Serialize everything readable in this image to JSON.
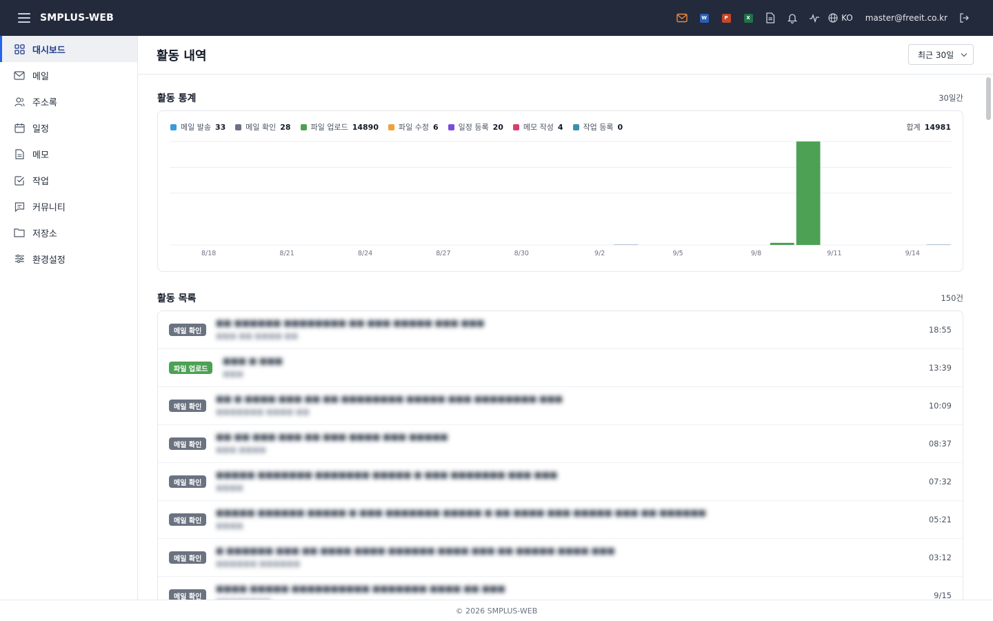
{
  "app": {
    "title": "SMPLUS-WEB"
  },
  "header": {
    "icons": [
      "mail-icon",
      "word-icon",
      "powerpoint-icon",
      "excel-icon",
      "document-icon",
      "bell-icon",
      "activity-icon"
    ],
    "apps": {
      "word": "W",
      "ppt": "P",
      "excel": "X"
    },
    "language": "KO",
    "user_email": "master@freeit.co.kr"
  },
  "sidebar": {
    "items": [
      {
        "label": "대시보드",
        "icon": "dashboard-icon"
      },
      {
        "label": "메일",
        "icon": "mail-icon"
      },
      {
        "label": "주소록",
        "icon": "contacts-icon"
      },
      {
        "label": "일정",
        "icon": "calendar-icon"
      },
      {
        "label": "메모",
        "icon": "memo-icon"
      },
      {
        "label": "작업",
        "icon": "task-icon"
      },
      {
        "label": "커뮤니티",
        "icon": "community-icon"
      },
      {
        "label": "저장소",
        "icon": "folder-icon"
      },
      {
        "label": "환경설정",
        "icon": "settings-icon"
      }
    ]
  },
  "page": {
    "title": "활동 내역",
    "period": "최근 30일"
  },
  "stats": {
    "title": "활동 통계",
    "range": "30일간",
    "legend": [
      {
        "label": "메일 발송",
        "count": "33",
        "color": "#3b9ad9"
      },
      {
        "label": "메일 확인",
        "count": "28",
        "color": "#6b7285"
      },
      {
        "label": "파일 업로드",
        "count": "14890",
        "color": "#4ca155"
      },
      {
        "label": "파일 수정",
        "count": "6",
        "color": "#f0a13a"
      },
      {
        "label": "일정 등록",
        "count": "20",
        "color": "#7c4ddb"
      },
      {
        "label": "메모 작성",
        "count": "4",
        "color": "#d63f6e"
      },
      {
        "label": "작업 등록",
        "count": "0",
        "color": "#3a8fb0"
      }
    ],
    "total_label": "합계",
    "total": "14981"
  },
  "chart_data": {
    "type": "bar",
    "stacked": true,
    "x_tick_labels": [
      "8/18",
      "8/21",
      "8/24",
      "8/27",
      "8/30",
      "9/2",
      "9/5",
      "9/8",
      "9/11",
      "9/14"
    ],
    "categories": [
      "8/17",
      "8/18",
      "8/19",
      "8/20",
      "8/21",
      "8/22",
      "8/23",
      "8/24",
      "8/25",
      "8/26",
      "8/27",
      "8/28",
      "8/29",
      "8/30",
      "8/31",
      "9/1",
      "9/2",
      "9/3",
      "9/4",
      "9/5",
      "9/6",
      "9/7",
      "9/8",
      "9/9",
      "9/10",
      "9/11",
      "9/12",
      "9/13",
      "9/14",
      "9/15"
    ],
    "series": [
      {
        "name": "메일 발송",
        "values": [
          0,
          0,
          0,
          0,
          0,
          0,
          0,
          0,
          0,
          0,
          0,
          0,
          0,
          0,
          0,
          0,
          0,
          2,
          0,
          0,
          0,
          0,
          0,
          0,
          2,
          0,
          0,
          0,
          0,
          1
        ]
      },
      {
        "name": "메일 확인",
        "values": [
          0,
          0,
          0,
          0,
          0,
          0,
          0,
          0,
          0,
          0,
          0,
          0,
          0,
          0,
          0,
          0,
          0,
          2,
          0,
          0,
          0,
          0,
          0,
          0,
          2,
          0,
          0,
          0,
          0,
          1
        ]
      },
      {
        "name": "파일 업로드",
        "values": [
          0,
          0,
          0,
          0,
          0,
          0,
          0,
          0,
          0,
          0,
          0,
          0,
          0,
          0,
          0,
          0,
          0,
          0,
          0,
          0,
          0,
          0,
          0,
          300,
          14590,
          0,
          0,
          0,
          0,
          0
        ]
      },
      {
        "name": "파일 수정",
        "values": [
          0,
          0,
          0,
          0,
          0,
          0,
          0,
          0,
          0,
          0,
          0,
          0,
          0,
          0,
          0,
          0,
          0,
          0,
          0,
          0,
          0,
          0,
          0,
          0,
          0,
          0,
          0,
          0,
          0,
          0
        ]
      },
      {
        "name": "일정 등록",
        "values": [
          0,
          0,
          0,
          0,
          0,
          0,
          0,
          0,
          0,
          0,
          0,
          0,
          0,
          0,
          0,
          0,
          0,
          0,
          0,
          0,
          0,
          0,
          0,
          0,
          0,
          0,
          0,
          0,
          0,
          0
        ]
      },
      {
        "name": "메모 작성",
        "values": [
          0,
          0,
          0,
          0,
          0,
          0,
          0,
          0,
          0,
          0,
          0,
          0,
          0,
          0,
          0,
          0,
          0,
          0,
          0,
          0,
          0,
          0,
          0,
          0,
          0,
          0,
          0,
          0,
          0,
          0
        ]
      },
      {
        "name": "작업 등록",
        "values": [
          0,
          0,
          0,
          0,
          0,
          0,
          0,
          0,
          0,
          0,
          0,
          0,
          0,
          0,
          0,
          0,
          0,
          0,
          0,
          0,
          0,
          0,
          0,
          0,
          0,
          0,
          0,
          0,
          0,
          0
        ]
      }
    ],
    "ylim": [
      0,
      14600
    ],
    "grid": true,
    "legend": "top-left"
  },
  "activity": {
    "title": "활동 목록",
    "count": "150건",
    "colors": {
      "mail_read": "#6b7280",
      "file_upload": "#4ca155"
    },
    "rows": [
      {
        "type": "메일 확인",
        "kind": "mail_read",
        "title": "■■ ■■■■■■ ■■■■■■■■ ■■ ■■■ ■■■■■ ■■■ ■■■",
        "sub": "■■■ ■■ ■■■■ ■■",
        "time": "18:55"
      },
      {
        "type": "파일 업로드",
        "kind": "file_upload",
        "title": "■■■ ■ ■■■",
        "sub": "■■■",
        "time": "13:39"
      },
      {
        "type": "메일 확인",
        "kind": "mail_read",
        "title": "■■ ■ ■■■■ ■■■ ■■ ■■ ■■■■■■■■ ■■■■■ ■■■ ■■■■■■■■ ■■■",
        "sub": "■■■■■■■ ■■■■ ■■",
        "time": "10:09"
      },
      {
        "type": "메일 확인",
        "kind": "mail_read",
        "title": "■■ ■■ ■■■ ■■■ ■■ ■■■ ■■■■ ■■■ ■■■■■",
        "sub": "■■■ ■■■■",
        "time": "08:37"
      },
      {
        "type": "메일 확인",
        "kind": "mail_read",
        "title": "■■■■■ ■■■■■■■ ■■■■■■■ ■■■■■ ■ ■■■ ■■■■■■■ ■■■ ■■■",
        "sub": "■■■■",
        "time": "07:32"
      },
      {
        "type": "메일 확인",
        "kind": "mail_read",
        "title": "■■■■■ ■■■■■■ ■■■■■ ■ ■■■ ■■■■■■■ ■■■■■ ■ ■■ ■■■■ ■■■ ■■■■■ ■■■ ■■ ■■■■■■",
        "sub": "■■■■",
        "time": "05:21"
      },
      {
        "type": "메일 확인",
        "kind": "mail_read",
        "title": "■ ■■■■■■ ■■■ ■■ ■■■■ ■■■■ ■■■■■■ ■■■■ ■■■ ■■ ■■■■■ ■■■■ ■■■",
        "sub": "■■■■■■ ■■■■■■",
        "time": "03:12"
      },
      {
        "type": "메일 확인",
        "kind": "mail_read",
        "title": "■■■■ ■■■■■ ■■■■■■■■■■ ■■■■■■■ ■■■■ ■■ ■■■",
        "sub": "■■■■■■■■",
        "time": "9/15"
      }
    ]
  },
  "footer": {
    "text": "© 2026 SMPLUS-WEB"
  }
}
